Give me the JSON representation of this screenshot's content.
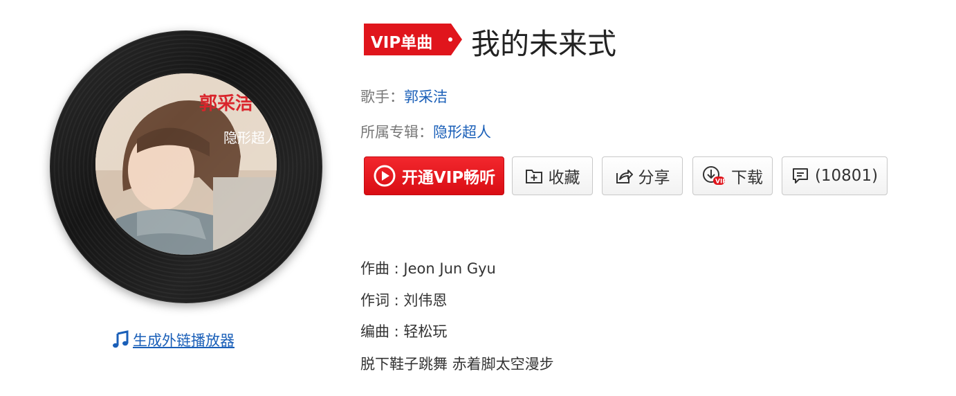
{
  "song": {
    "vip_tag": "VIP单曲",
    "title": "我的未来式",
    "singer_label": "歌手：",
    "singer": "郭采洁",
    "album_label": "所属专辑：",
    "album": "隐形超人"
  },
  "actions": {
    "vip_listen": "开通VIP畅听",
    "favorite": "收藏",
    "share": "分享",
    "download": "下载",
    "comments": "(10801)"
  },
  "credits": {
    "composer": "作曲 : Jeon Jun Gyu",
    "lyricist": "作词 : 刘伟恩",
    "arranger": "编曲 : 轻松玩",
    "first_lyric": "脱下鞋子跳舞 赤着脚太空漫步"
  },
  "player": {
    "link_text": "生成外链播放器"
  },
  "cover_text": {
    "artist": "郭采洁",
    "album": "隐形超人"
  },
  "colors": {
    "vip_red": "#e0151c",
    "link_blue": "#1a5fb8"
  },
  "icons": [
    "play-circle-icon",
    "folder-plus-icon",
    "share-icon",
    "download-vip-icon",
    "comment-icon",
    "music-note-icon"
  ]
}
